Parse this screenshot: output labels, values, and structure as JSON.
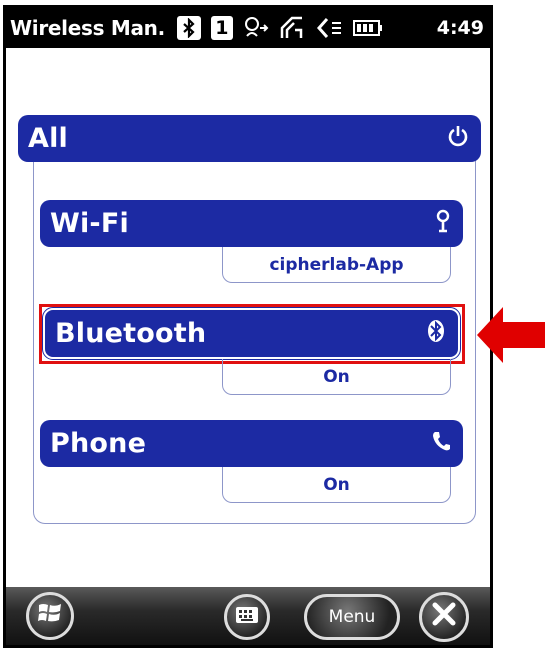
{
  "status_bar": {
    "title": "Wireless Man.",
    "icons": [
      "bluetooth-icon",
      "one-icon",
      "network-icon",
      "phone-signal-icon",
      "volume-icon",
      "battery-icon"
    ],
    "one_label": "1",
    "time": "4:49"
  },
  "groups": {
    "all": {
      "label": "All",
      "icon": "power-icon"
    },
    "wifi": {
      "label": "Wi-Fi",
      "icon": "wifi-antenna-icon",
      "status": "cipherlab-App"
    },
    "bluetooth": {
      "label": "Bluetooth",
      "icon": "bluetooth-icon",
      "status": "On"
    },
    "phone": {
      "label": "Phone",
      "icon": "phone-icon",
      "status": "On"
    }
  },
  "taskbar": {
    "menu_label": "Menu",
    "start_icon": "windows-logo-icon",
    "keyboard_icon": "keyboard-icon",
    "close_icon": "close-icon"
  },
  "colors": {
    "bar": "#1c2aa3",
    "highlight": "#e01010",
    "arrow": "#e00000"
  }
}
